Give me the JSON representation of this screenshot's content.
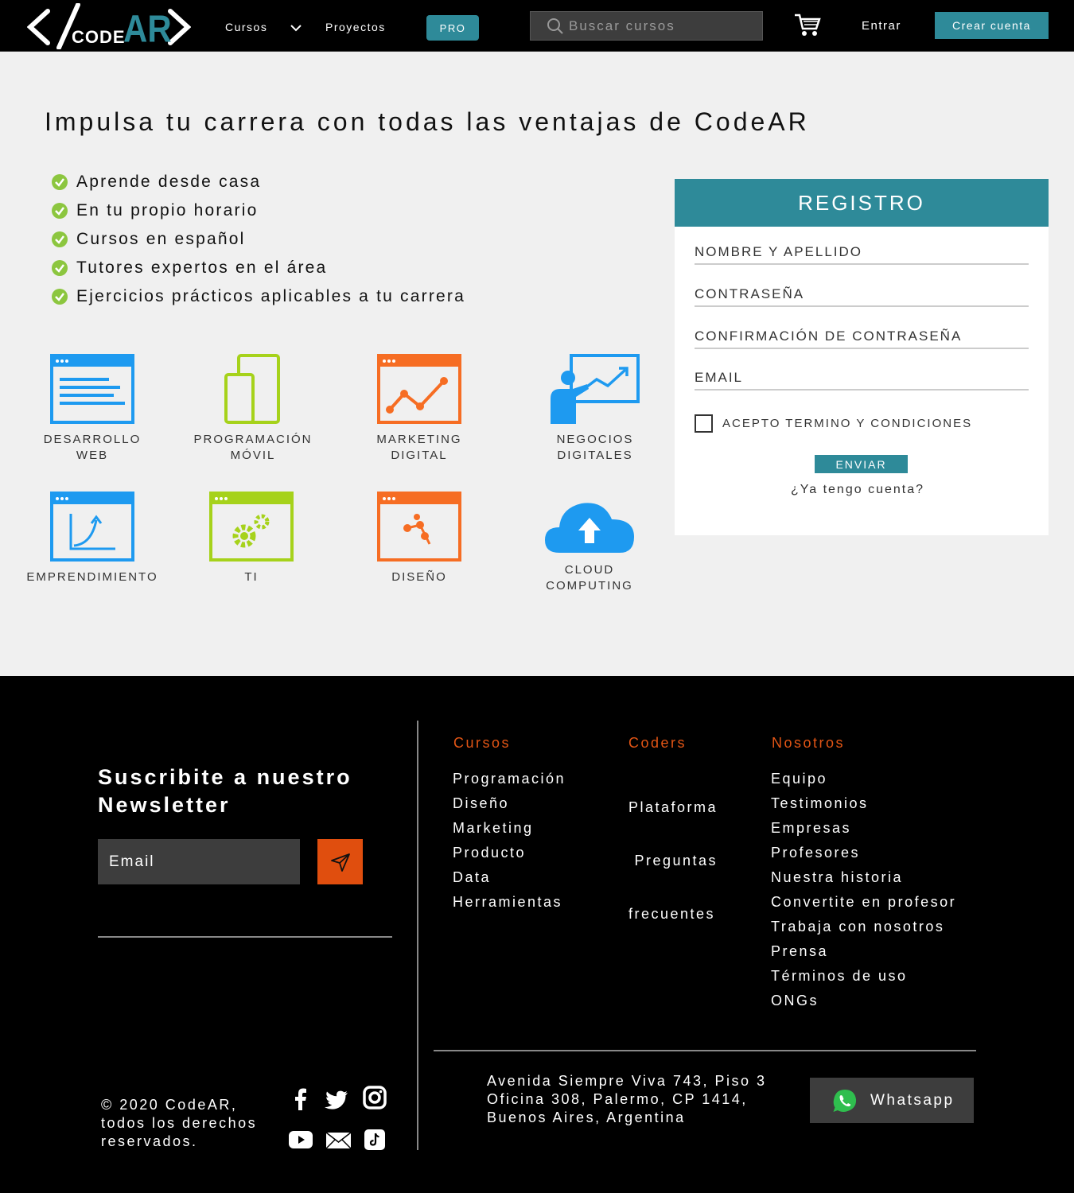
{
  "header": {
    "logo_text": "CODE",
    "logo_accent": "AR",
    "nav_courses": "Cursos",
    "nav_projects": "Proyectos",
    "pro_label": "PRO",
    "search_placeholder": "Buscar cursos",
    "login_label": "Entrar",
    "signup_label": "Crear cuenta"
  },
  "main": {
    "headline": "Impulsa tu carrera con todas las ventajas de CodeAR",
    "benefits": [
      "Aprende desde casa",
      "En tu propio horario",
      "Cursos en español",
      "Tutores expertos en el área",
      "Ejercicios prácticos aplicables a tu carrera"
    ],
    "categories": [
      {
        "label": "DESARROLLO\nWEB",
        "icon": "browser-text-icon"
      },
      {
        "label": "PROGRAMACIÓN\nMÓVIL",
        "icon": "mobile-devices-icon"
      },
      {
        "label": "MARKETING\nDIGITAL",
        "icon": "browser-chart-icon"
      },
      {
        "label": "NEGOCIOS\nDIGITALES",
        "icon": "presentation-icon"
      },
      {
        "label": "EMPRENDIMIENTO",
        "icon": "browser-growth-icon"
      },
      {
        "label": "TI",
        "icon": "browser-gears-icon"
      },
      {
        "label": "DISEÑO",
        "icon": "browser-vector-icon"
      },
      {
        "label": "CLOUD\nCOMPUTING",
        "icon": "cloud-upload-icon"
      }
    ]
  },
  "form": {
    "title": "REGISTRO",
    "name_placeholder": "NOMBRE Y APELLIDO",
    "password_placeholder": "CONTRASEÑA",
    "confirm_placeholder": "CONFIRMACIÓN DE CONTRASEÑA",
    "email_placeholder": "EMAIL",
    "terms_label": "ACEPTO TERMINO Y CONDICIONES",
    "submit_label": "ENVIAR",
    "have_account": "¿Ya tengo cuenta?"
  },
  "footer": {
    "newsletter_title": "Suscribite a nuestro Newsletter",
    "newsletter_placeholder": "Email",
    "columns": [
      {
        "title": "Cursos",
        "items": [
          "Programación",
          "Diseño",
          "Marketing",
          "Producto",
          "Data",
          "Herramientas"
        ]
      },
      {
        "title": "Coders",
        "items": [
          "Plataforma",
          " Preguntas",
          "frecuentes"
        ]
      },
      {
        "title": "Nosotros",
        "items": [
          "Equipo",
          "Testimonios",
          "Empresas",
          "Profesores",
          "Nuestra historia",
          "Convertite en profesor",
          "Trabaja con nosotros",
          "Prensa",
          "Términos de uso",
          "ONGs"
        ]
      }
    ],
    "copyright": "© 2020 CodeAR,\ntodos los derechos\nreservados.",
    "address": "Avenida Siempre Viva 743, Piso 3\nOficina 308, Palermo, CP 1414,\nBuenos Aires, Argentina",
    "whatsapp_label": "Whatsapp"
  },
  "colors": {
    "accent": "#2e8a99",
    "footer_accent": "#e25515",
    "check_green": "#8cc63f",
    "icon_blue": "#1e9af0",
    "icon_lime": "#a6d21b",
    "icon_orange": "#f66d23"
  }
}
